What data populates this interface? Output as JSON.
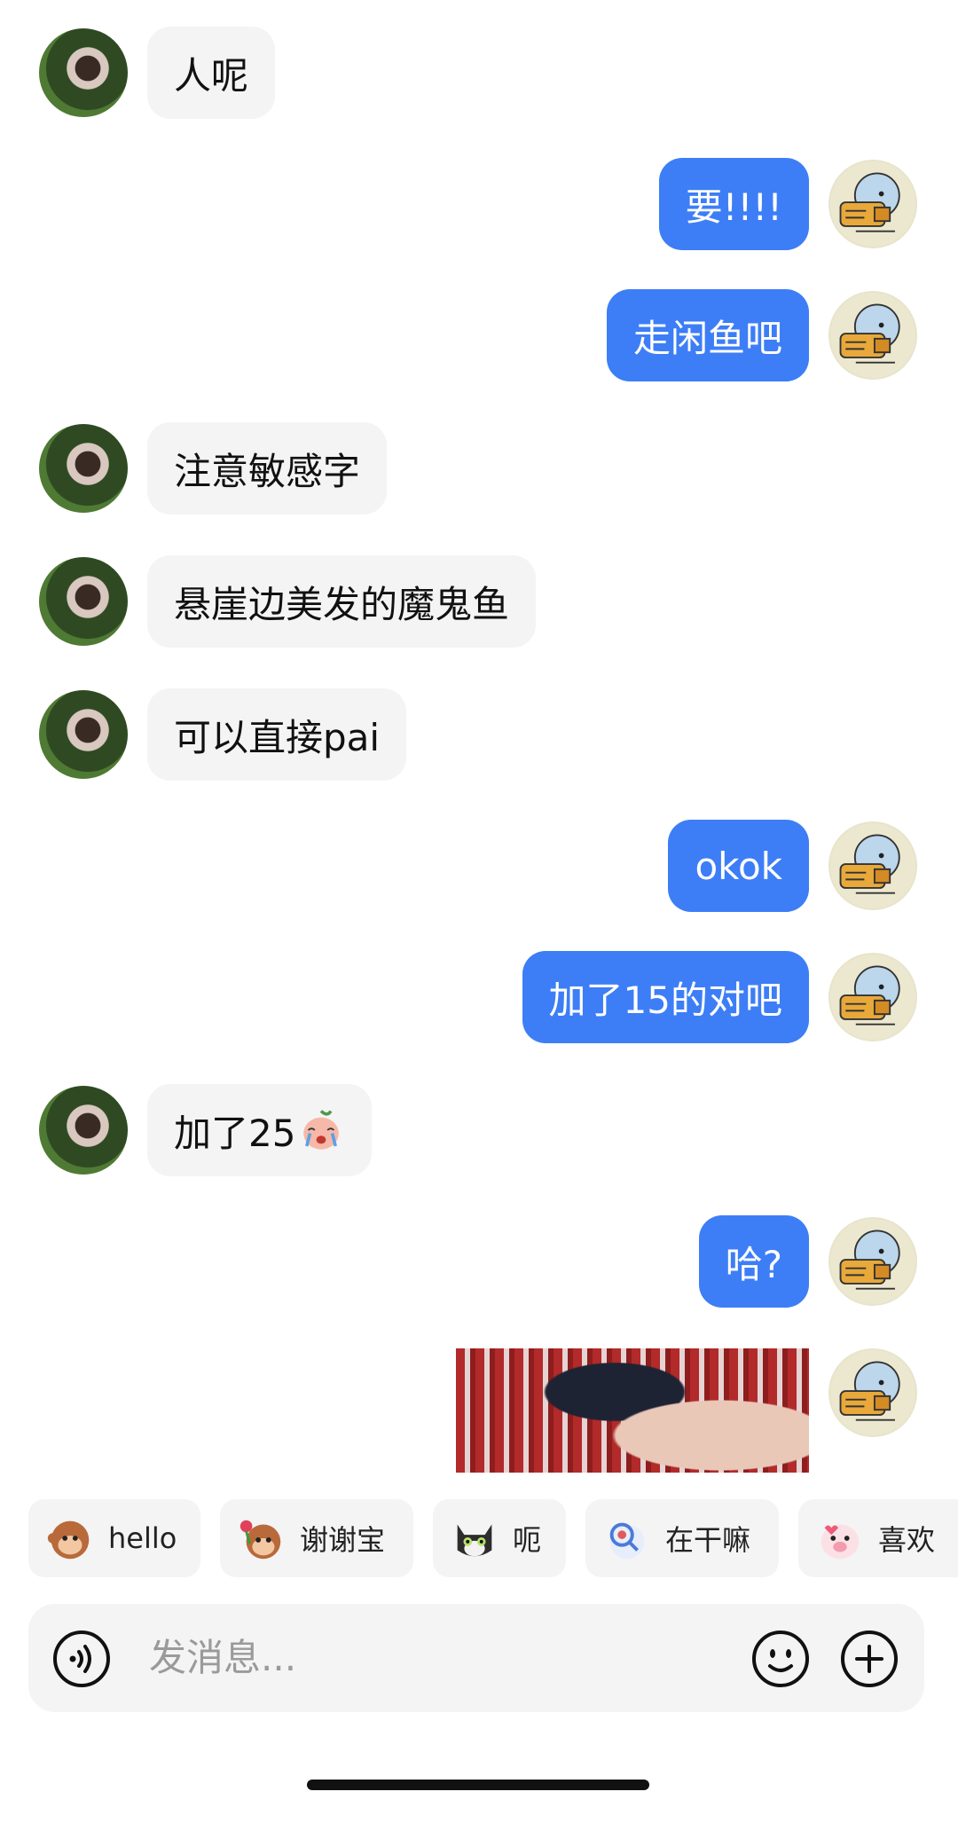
{
  "messages": [
    {
      "side": "left",
      "text": "人呢"
    },
    {
      "side": "right",
      "text": "要!!!!"
    },
    {
      "side": "right",
      "text": "走闲鱼吧"
    },
    {
      "side": "left",
      "text": "注意敏感字"
    },
    {
      "side": "left",
      "text": "悬崖边美发的魔鬼鱼"
    },
    {
      "side": "left",
      "text": "可以直接pai"
    },
    {
      "side": "right",
      "text": "okok"
    },
    {
      "side": "right",
      "text": "加了15的对吧"
    },
    {
      "side": "left",
      "text": "加了25",
      "emoji": "crying-peach-emoji"
    },
    {
      "side": "right",
      "text": "哈?"
    }
  ],
  "quick_replies": [
    {
      "label": "hello",
      "icon": "monkey-wave-icon"
    },
    {
      "label": "谢谢宝",
      "icon": "monkey-flower-icon"
    },
    {
      "label": "呃",
      "icon": "cat-icon"
    },
    {
      "label": "在干嘛",
      "icon": "bird-magnifier-icon"
    },
    {
      "label": "喜欢",
      "icon": "pig-heart-icon"
    }
  ],
  "input": {
    "placeholder": "发消息..."
  },
  "colors": {
    "sent_bubble": "#3d7ef7",
    "received_bubble": "#f4f4f4",
    "sent_text": "#ffffff",
    "received_text": "#111111"
  }
}
